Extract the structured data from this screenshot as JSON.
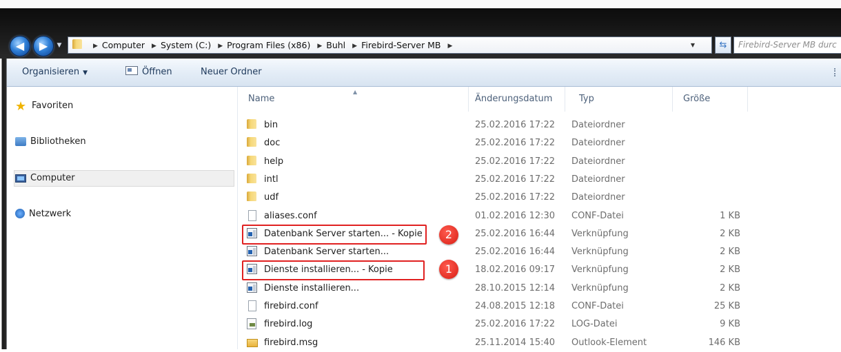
{
  "address_bar": {
    "crumbs": [
      "Computer",
      "System (C:)",
      "Program Files (x86)",
      "Buhl",
      "Firebird-Server MB"
    ],
    "search_placeholder": "Firebird-Server MB durc"
  },
  "toolbar": {
    "organize_label": "Organisieren",
    "open_label": "Öffnen",
    "new_folder_label": "Neuer Ordner"
  },
  "navigation": {
    "favorites": "Favoriten",
    "libraries": "Bibliotheken",
    "computer": "Computer",
    "network": "Netzwerk"
  },
  "columns": {
    "name": "Name",
    "date": "Änderungsdatum",
    "type": "Typ",
    "size": "Größe"
  },
  "files": [
    {
      "name": "bin",
      "date": "25.02.2016 17:22",
      "type": "Dateiordner",
      "size": "",
      "icon": "folder-icon"
    },
    {
      "name": "doc",
      "date": "25.02.2016 17:22",
      "type": "Dateiordner",
      "size": "",
      "icon": "folder-icon"
    },
    {
      "name": "help",
      "date": "25.02.2016 17:22",
      "type": "Dateiordner",
      "size": "",
      "icon": "folder-icon"
    },
    {
      "name": "intl",
      "date": "25.02.2016 17:22",
      "type": "Dateiordner",
      "size": "",
      "icon": "folder-icon"
    },
    {
      "name": "udf",
      "date": "25.02.2016 17:22",
      "type": "Dateiordner",
      "size": "",
      "icon": "folder-icon"
    },
    {
      "name": "aliases.conf",
      "date": "01.02.2016 12:30",
      "type": "CONF-Datei",
      "size": "1 KB",
      "icon": "document-icon"
    },
    {
      "name": "Datenbank Server starten... - Kopie",
      "date": "25.02.2016 16:44",
      "type": "Verknüpfung",
      "size": "2 KB",
      "icon": "shortcut-icon"
    },
    {
      "name": "Datenbank Server starten...",
      "date": "25.02.2016 16:44",
      "type": "Verknüpfung",
      "size": "2 KB",
      "icon": "shortcut-icon"
    },
    {
      "name": "Dienste installieren... - Kopie",
      "date": "18.02.2016 09:17",
      "type": "Verknüpfung",
      "size": "2 KB",
      "icon": "shortcut-icon"
    },
    {
      "name": "Dienste installieren...",
      "date": "28.10.2015 12:14",
      "type": "Verknüpfung",
      "size": "2 KB",
      "icon": "shortcut-icon"
    },
    {
      "name": "firebird.conf",
      "date": "24.08.2015 12:18",
      "type": "CONF-Datei",
      "size": "25 KB",
      "icon": "document-icon"
    },
    {
      "name": "firebird.log",
      "date": "25.02.2016 17:22",
      "type": "LOG-Datei",
      "size": "9 KB",
      "icon": "log-file-icon"
    },
    {
      "name": "firebird.msg",
      "date": "25.11.2014 15:40",
      "type": "Outlook-Element",
      "size": "146 KB",
      "icon": "mail-icon"
    }
  ],
  "annotations": {
    "badge_1": "1",
    "badge_2": "2",
    "color": "#e02020"
  },
  "colors": {
    "toolbar_text": "#1e395b",
    "header_text": "#4c607a",
    "meta_text": "#6d6d6d"
  }
}
